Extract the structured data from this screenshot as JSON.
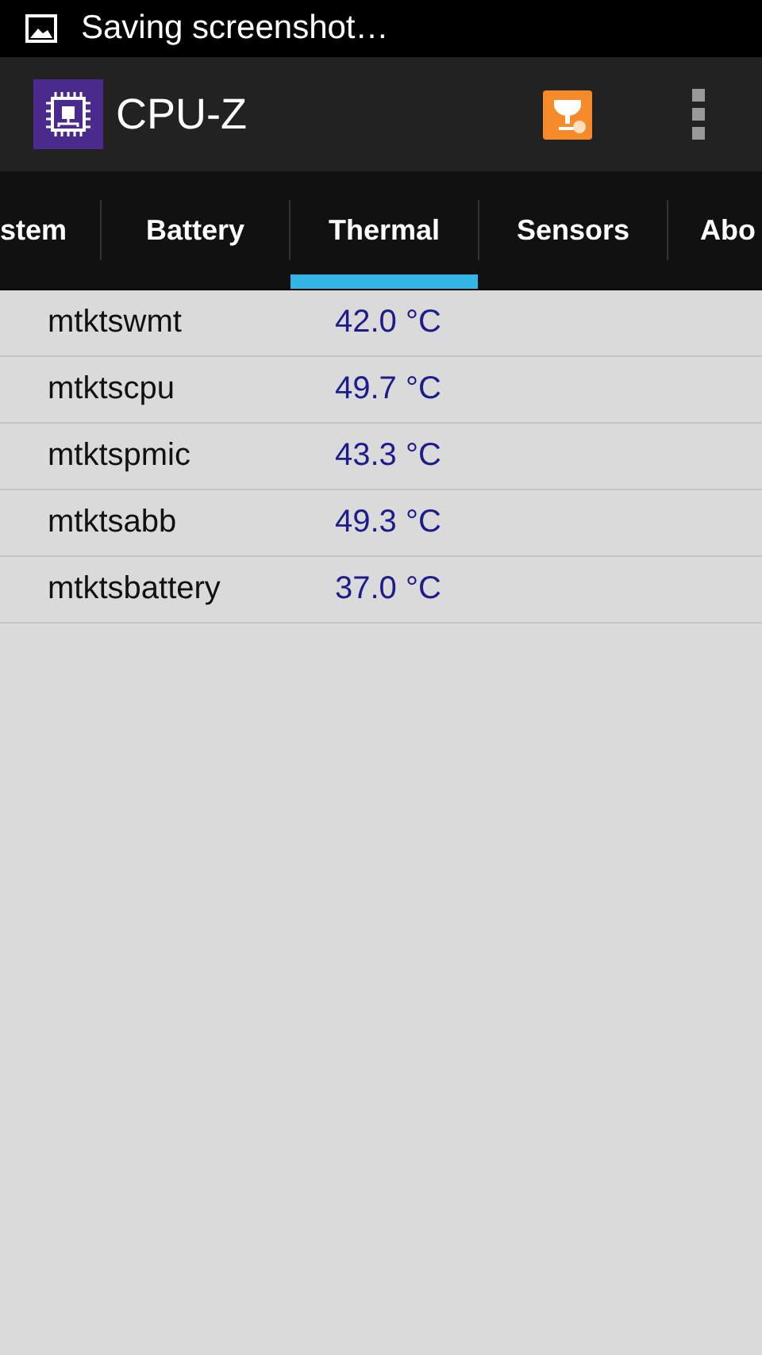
{
  "status_bar": {
    "notification": "Saving screenshot…"
  },
  "app_bar": {
    "title": "CPU-Z"
  },
  "tabs": [
    {
      "label": "stem",
      "selected": false
    },
    {
      "label": "Battery",
      "selected": false
    },
    {
      "label": "Thermal",
      "selected": true
    },
    {
      "label": "Sensors",
      "selected": false
    },
    {
      "label": "Abo",
      "selected": false
    }
  ],
  "rows": [
    {
      "name": "mtktswmt",
      "value": "42.0 °C"
    },
    {
      "name": "mtktscpu",
      "value": "49.7 °C"
    },
    {
      "name": "mtktspmic",
      "value": "43.3 °C"
    },
    {
      "name": "mtktsabb",
      "value": "49.3 °C"
    },
    {
      "name": "mtktsbattery",
      "value": "37.0 °C"
    }
  ]
}
